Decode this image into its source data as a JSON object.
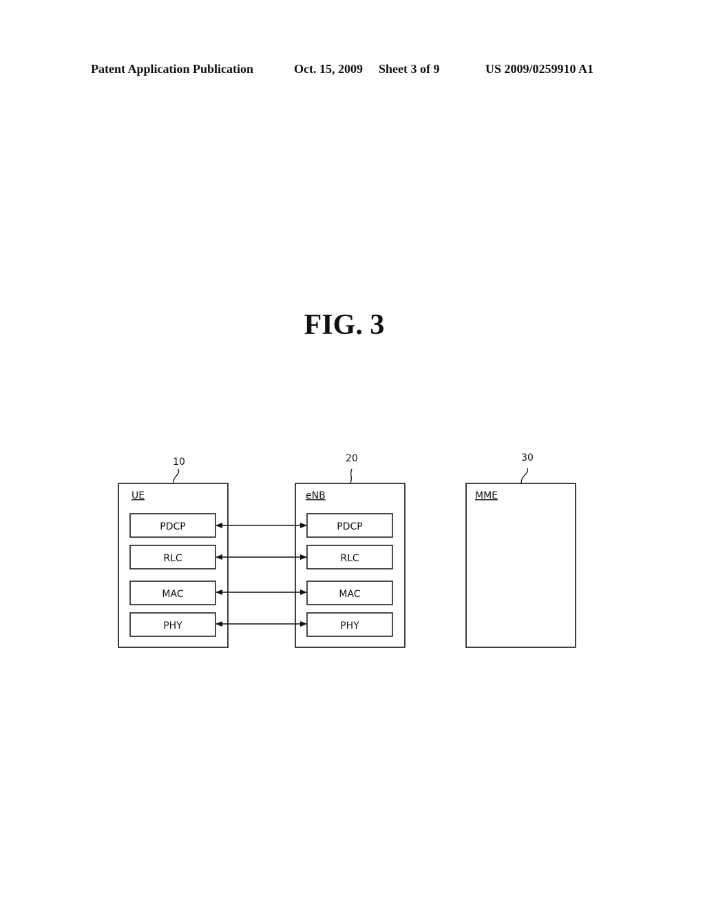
{
  "header": {
    "publication": "Patent Application Publication",
    "date": "Oct. 15, 2009",
    "sheet": "Sheet 3 of 9",
    "number": "US 2009/0259910 A1"
  },
  "figure": {
    "title": "FIG. 3",
    "entities": [
      {
        "ref": "10",
        "label": "UE",
        "layers": [
          "PDCP",
          "RLC",
          "MAC",
          "PHY"
        ]
      },
      {
        "ref": "20",
        "label": "eNB",
        "layers": [
          "PDCP",
          "RLC",
          "MAC",
          "PHY"
        ]
      },
      {
        "ref": "30",
        "label": "MME",
        "layers": []
      }
    ],
    "connections": [
      {
        "from": "UE.PDCP",
        "to": "eNB.PDCP",
        "type": "bidirectional"
      },
      {
        "from": "UE.RLC",
        "to": "eNB.RLC",
        "type": "bidirectional"
      },
      {
        "from": "UE.MAC",
        "to": "eNB.MAC",
        "type": "bidirectional"
      },
      {
        "from": "UE.PHY",
        "to": "eNB.PHY",
        "type": "bidirectional"
      }
    ]
  }
}
